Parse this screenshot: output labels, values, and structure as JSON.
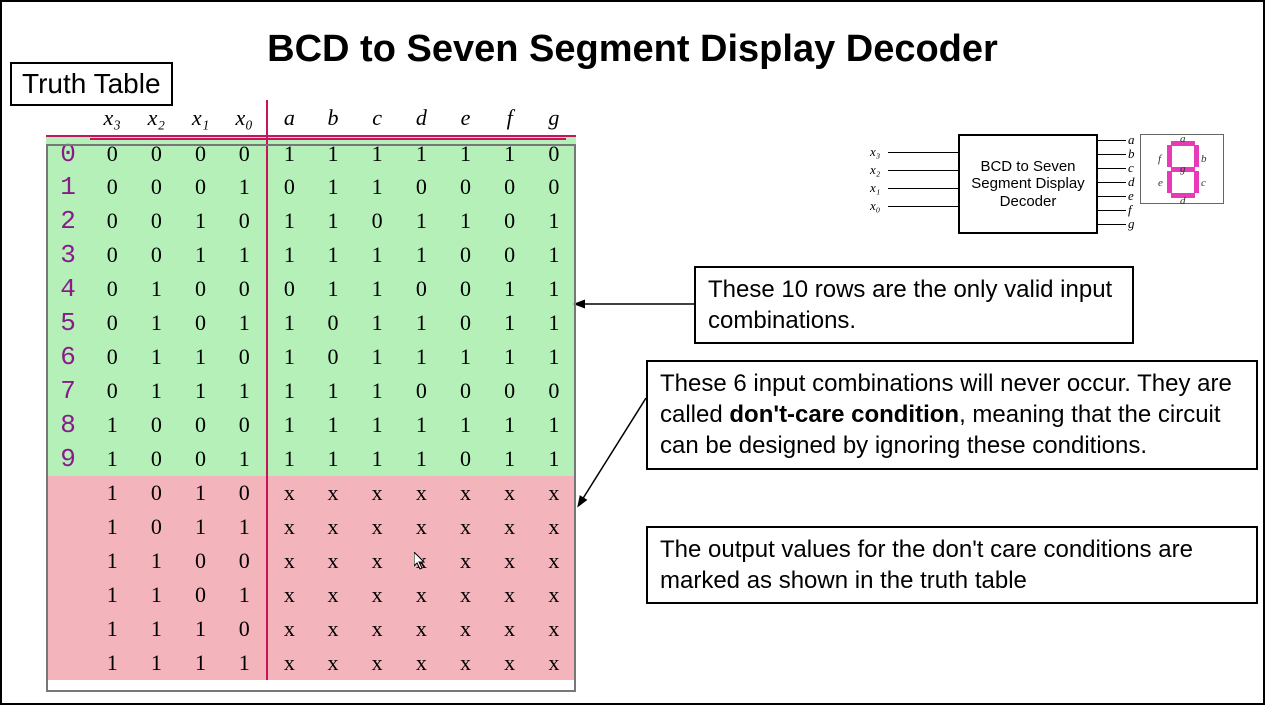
{
  "title": "BCD to Seven Segment Display Decoder",
  "truth_table_label": "Truth Table",
  "headers_in": [
    "x₃",
    "x₂",
    "x₁",
    "x₀"
  ],
  "headers_out": [
    "a",
    "b",
    "c",
    "d",
    "e",
    "f",
    "g"
  ],
  "digits": [
    "0",
    "1",
    "2",
    "3",
    "4",
    "5",
    "6",
    "7",
    "8",
    "9"
  ],
  "rows_valid": [
    {
      "in": [
        "0",
        "0",
        "0",
        "0"
      ],
      "out": [
        "1",
        "1",
        "1",
        "1",
        "1",
        "1",
        "0"
      ]
    },
    {
      "in": [
        "0",
        "0",
        "0",
        "1"
      ],
      "out": [
        "0",
        "1",
        "1",
        "0",
        "0",
        "0",
        "0"
      ]
    },
    {
      "in": [
        "0",
        "0",
        "1",
        "0"
      ],
      "out": [
        "1",
        "1",
        "0",
        "1",
        "1",
        "0",
        "1"
      ]
    },
    {
      "in": [
        "0",
        "0",
        "1",
        "1"
      ],
      "out": [
        "1",
        "1",
        "1",
        "1",
        "0",
        "0",
        "1"
      ]
    },
    {
      "in": [
        "0",
        "1",
        "0",
        "0"
      ],
      "out": [
        "0",
        "1",
        "1",
        "0",
        "0",
        "1",
        "1"
      ]
    },
    {
      "in": [
        "0",
        "1",
        "0",
        "1"
      ],
      "out": [
        "1",
        "0",
        "1",
        "1",
        "0",
        "1",
        "1"
      ]
    },
    {
      "in": [
        "0",
        "1",
        "1",
        "0"
      ],
      "out": [
        "1",
        "0",
        "1",
        "1",
        "1",
        "1",
        "1"
      ]
    },
    {
      "in": [
        "0",
        "1",
        "1",
        "1"
      ],
      "out": [
        "1",
        "1",
        "1",
        "0",
        "0",
        "0",
        "0"
      ]
    },
    {
      "in": [
        "1",
        "0",
        "0",
        "0"
      ],
      "out": [
        "1",
        "1",
        "1",
        "1",
        "1",
        "1",
        "1"
      ]
    },
    {
      "in": [
        "1",
        "0",
        "0",
        "1"
      ],
      "out": [
        "1",
        "1",
        "1",
        "1",
        "0",
        "1",
        "1"
      ]
    }
  ],
  "rows_dontcare": [
    {
      "in": [
        "1",
        "0",
        "1",
        "0"
      ],
      "out": [
        "x",
        "x",
        "x",
        "x",
        "x",
        "x",
        "x"
      ]
    },
    {
      "in": [
        "1",
        "0",
        "1",
        "1"
      ],
      "out": [
        "x",
        "x",
        "x",
        "x",
        "x",
        "x",
        "x"
      ]
    },
    {
      "in": [
        "1",
        "1",
        "0",
        "0"
      ],
      "out": [
        "x",
        "x",
        "x",
        "x",
        "x",
        "x",
        "x"
      ]
    },
    {
      "in": [
        "1",
        "1",
        "0",
        "1"
      ],
      "out": [
        "x",
        "x",
        "x",
        "x",
        "x",
        "x",
        "x"
      ]
    },
    {
      "in": [
        "1",
        "1",
        "1",
        "0"
      ],
      "out": [
        "x",
        "x",
        "x",
        "x",
        "x",
        "x",
        "x"
      ]
    },
    {
      "in": [
        "1",
        "1",
        "1",
        "1"
      ],
      "out": [
        "x",
        "x",
        "x",
        "x",
        "x",
        "x",
        "x"
      ]
    }
  ],
  "callouts": {
    "c1": "These 10 rows are the only valid input combinations.",
    "c2_pre": "These 6 input combinations will never occur. They are called ",
    "c2_bold": "don't-care condition",
    "c2_post": ", meaning that the circuit can be designed by ignoring these conditions.",
    "c3": "The output values for the don't care conditions are marked as shown in the truth table"
  },
  "block": {
    "label": "BCD to Seven Segment Display Decoder",
    "inputs": [
      "x₃",
      "x₂",
      "x₁",
      "x₀"
    ],
    "outputs": [
      "a",
      "b",
      "c",
      "d",
      "e",
      "f",
      "g"
    ],
    "seg_labels": [
      "a",
      "b",
      "c",
      "d",
      "e",
      "f",
      "g"
    ]
  }
}
